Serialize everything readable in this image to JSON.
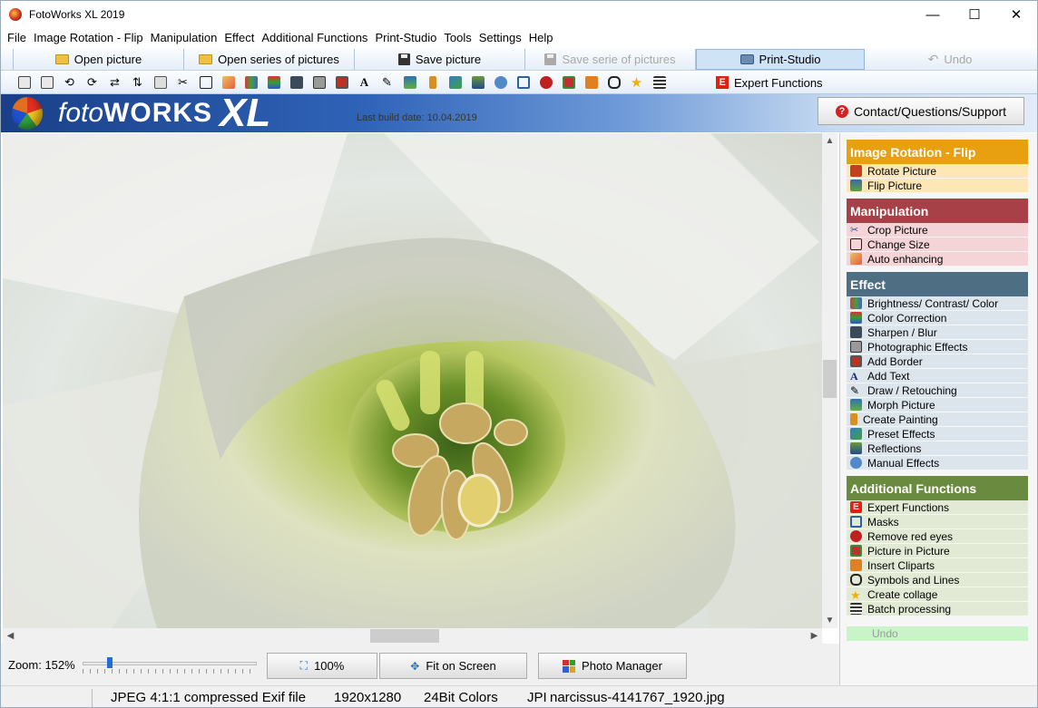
{
  "window": {
    "title": "FotoWorks XL 2019",
    "minimize": "—",
    "maximize": "☐",
    "close": "✕"
  },
  "menu": [
    "File",
    "Image Rotation - Flip",
    "Manipulation",
    "Effect",
    "Additional Functions",
    "Print-Studio",
    "Tools",
    "Settings",
    "Help"
  ],
  "toolbar": {
    "open_picture": "Open picture",
    "open_series": "Open series of pictures",
    "save_picture": "Save picture",
    "save_serie": "Save serie of pictures",
    "print_studio": "Print-Studio",
    "undo": "Undo"
  },
  "tools": {
    "icons": [
      "rotate-left-icon",
      "rotate-right-icon",
      "rotate-ccw-icon",
      "rotate-cw-icon",
      "flip-horizontal-icon",
      "flip-vertical-icon",
      "flip-icon",
      "crop-icon",
      "resize-icon",
      "auto-enhance-icon",
      "brightness-icon",
      "color-correction-icon",
      "sharpen-icon",
      "photo-effects-icon",
      "add-border-icon",
      "add-text-icon",
      "draw-icon",
      "morph-icon",
      "painting-icon",
      "preset-effects-icon",
      "reflections-icon",
      "manual-effects-icon",
      "masks-icon",
      "red-eye-icon",
      "picture-in-picture-icon",
      "cliparts-icon",
      "symbols-icon",
      "collage-icon",
      "batch-icon"
    ],
    "expert_functions": "Expert Functions"
  },
  "banner": {
    "logo_part1": "foto",
    "logo_part2": "WORKS",
    "logo_part3": "XL",
    "build_date": "Last build date: 10.04.2019",
    "contact_button": "Contact/Questions/Support"
  },
  "colors": {
    "rotation_header": "#e8a010",
    "rotation_bg": "#fde7b4",
    "manipulation_header": "#a84048",
    "manipulation_bg": "#f4d4d6",
    "effect_header": "#4e6e84",
    "effect_bg": "#dde5ec",
    "additional_header": "#6a8a40",
    "additional_bg": "#e2ead6"
  },
  "sidebar": {
    "sections": [
      {
        "title": "Image Rotation - Flip",
        "items": [
          "Rotate Picture",
          "Flip Picture"
        ]
      },
      {
        "title": "Manipulation",
        "items": [
          "Crop Picture",
          "Change Size",
          "Auto enhancing"
        ]
      },
      {
        "title": "Effect",
        "items": [
          "Brightness/ Contrast/ Color",
          "Color Correction",
          "Sharpen / Blur",
          "Photographic Effects",
          "Add Border",
          "Add Text",
          "Draw / Retouching",
          "Morph Picture",
          "Create Painting",
          "Preset Effects",
          "Reflections",
          "Manual Effects"
        ]
      },
      {
        "title": "Additional Functions",
        "items": [
          "Expert Functions",
          "Masks",
          "Remove red eyes",
          "Picture in Picture",
          "Insert Cliparts",
          "Symbols and Lines",
          "Create collage",
          "Batch processing"
        ]
      }
    ],
    "undo": "Undo"
  },
  "bottom": {
    "zoom_label": "Zoom: 152%",
    "zoom_value_pct": 152,
    "btn_100": "100%",
    "btn_fit": "Fit on Screen",
    "btn_manager": "Photo Manager"
  },
  "status": {
    "format": "JPEG 4:1:1 compressed Exif file",
    "resolution": "1920x1280",
    "colors": "24Bit Colors",
    "type_abbrev": "JPI",
    "filename": "narcissus-4141767_1920.jpg"
  }
}
